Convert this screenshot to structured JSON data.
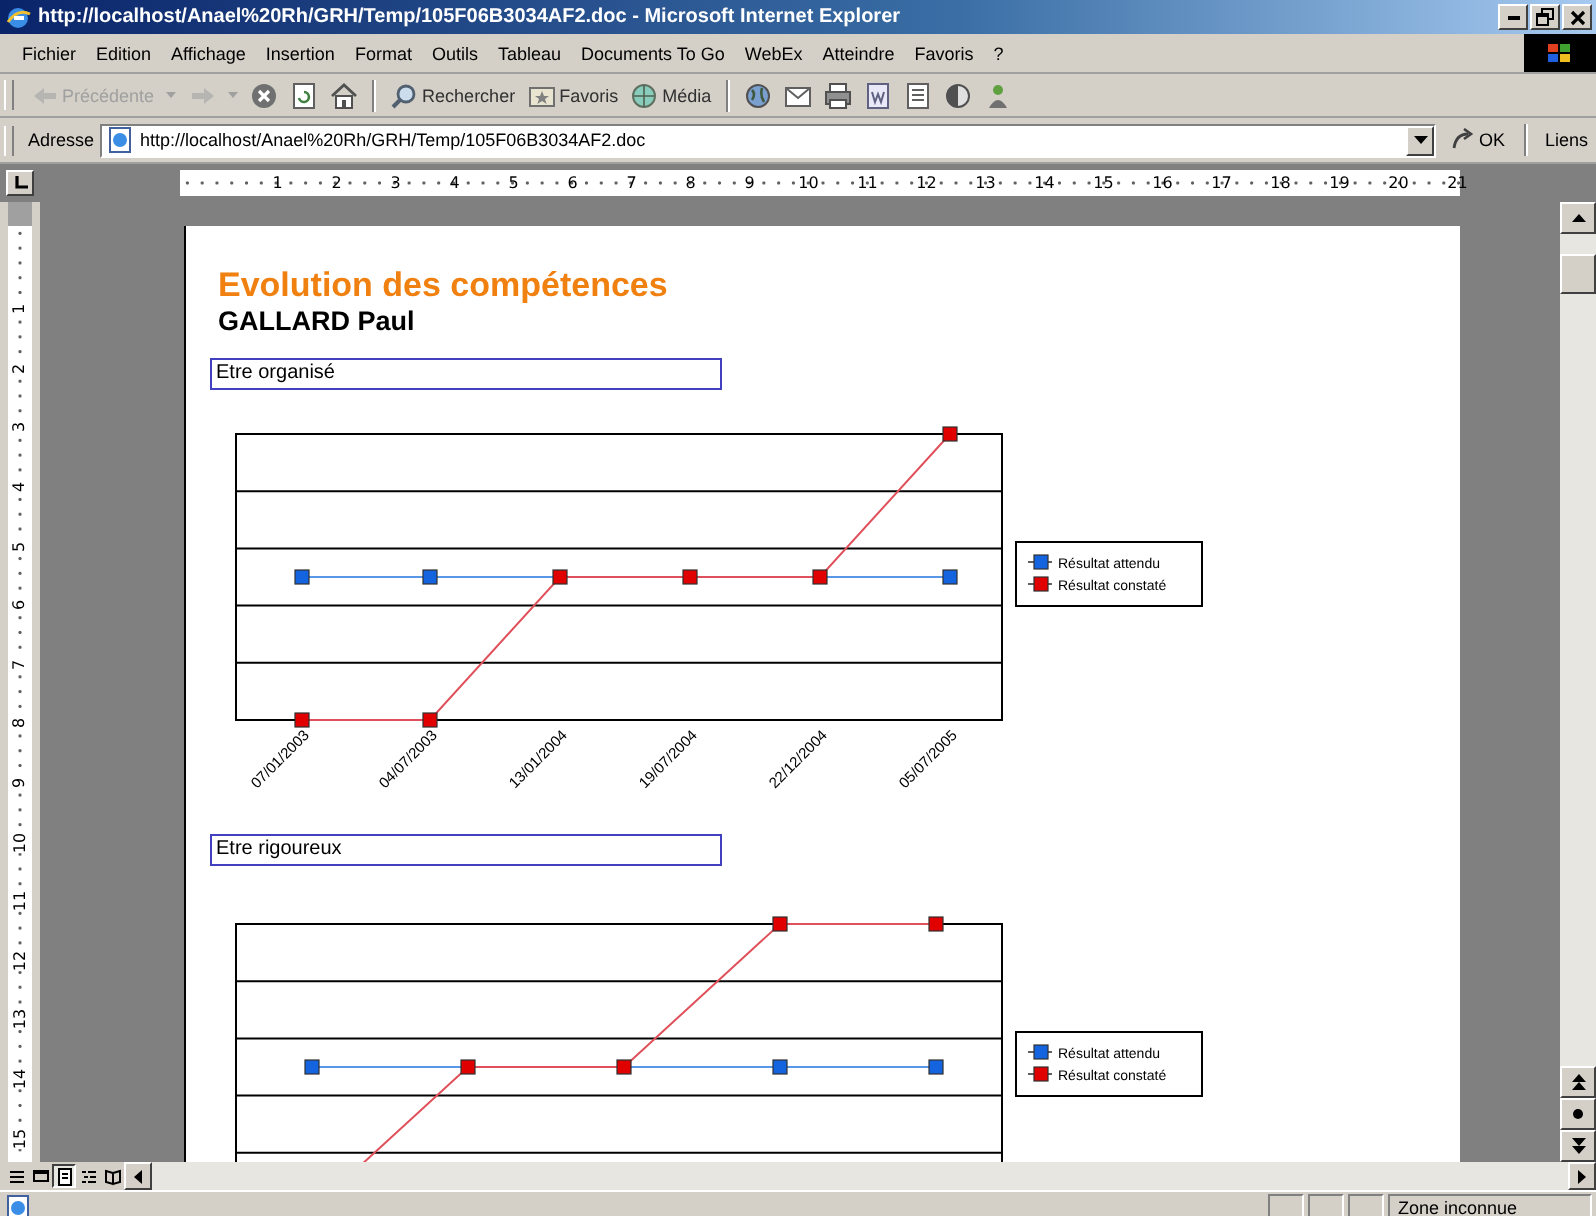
{
  "window": {
    "title": "http://localhost/Anael%20Rh/GRH/Temp/105F06B3034AF2.doc - Microsoft Internet Explorer"
  },
  "menu": [
    "Fichier",
    "Edition",
    "Affichage",
    "Insertion",
    "Format",
    "Outils",
    "Tableau",
    "Documents To Go",
    "WebEx",
    "Atteindre",
    "Favoris",
    "?"
  ],
  "toolbar": [
    {
      "kind": "back",
      "label": "Précédente",
      "disabled": true
    },
    {
      "kind": "forward",
      "disabled": true
    },
    {
      "kind": "stop",
      "disabled": false
    },
    {
      "kind": "refresh",
      "disabled": false
    },
    {
      "kind": "home",
      "disabled": false
    },
    {
      "kind": "search",
      "label": "Rechercher",
      "disabled": false
    },
    {
      "kind": "favorites",
      "label": "Favoris",
      "disabled": false
    },
    {
      "kind": "media",
      "label": "Média",
      "disabled": false
    },
    {
      "kind": "history",
      "disabled": false
    },
    {
      "kind": "mail",
      "disabled": false
    },
    {
      "kind": "print",
      "disabled": false
    },
    {
      "kind": "edit",
      "disabled": false
    },
    {
      "kind": "discuss",
      "disabled": false
    },
    {
      "kind": "messenger",
      "disabled": false
    },
    {
      "kind": "tools",
      "disabled": false
    }
  ],
  "address": {
    "label": "Adresse",
    "value": "http://localhost/Anael%20Rh/GRH/Temp/105F06B3034AF2.doc",
    "go": "OK",
    "links": "Liens"
  },
  "ruler": {
    "horizontal": [
      "1",
      "2",
      "3",
      "4",
      "5",
      "6",
      "7",
      "8",
      "9",
      "10",
      "11",
      "12",
      "13",
      "14",
      "15",
      "16",
      "17",
      "18",
      "19",
      "20",
      "21"
    ],
    "vertical": [
      "1",
      "2",
      "3",
      "4",
      "5",
      "6",
      "7",
      "8",
      "9",
      "10",
      "11",
      "12",
      "13",
      "14",
      "15"
    ]
  },
  "document": {
    "title": "Evolution des compétences",
    "subtitle": "GALLARD Paul",
    "charts": [
      {
        "caption": "Etre organisé",
        "categories": [
          "07/01/2003",
          "04/07/2003",
          "13/01/2004",
          "19/07/2004",
          "22/12/2004",
          "05/07/2005"
        ],
        "legend": [
          {
            "name": "Résultat attendu",
            "color": "#1464e0"
          },
          {
            "name": "Résultat constaté",
            "color": "#e00000"
          }
        ]
      },
      {
        "caption": "Etre rigoureux",
        "legend": [
          {
            "name": "Résultat attendu",
            "color": "#1464e0"
          },
          {
            "name": "Résultat constaté",
            "color": "#e00000"
          }
        ]
      }
    ]
  },
  "views": [
    {
      "kind": "normal",
      "selected": false
    },
    {
      "kind": "web",
      "selected": false
    },
    {
      "kind": "page",
      "selected": true
    },
    {
      "kind": "outline",
      "selected": false
    },
    {
      "kind": "reading",
      "selected": false
    }
  ],
  "status_bar": {
    "zone": "Zone inconnue"
  }
}
